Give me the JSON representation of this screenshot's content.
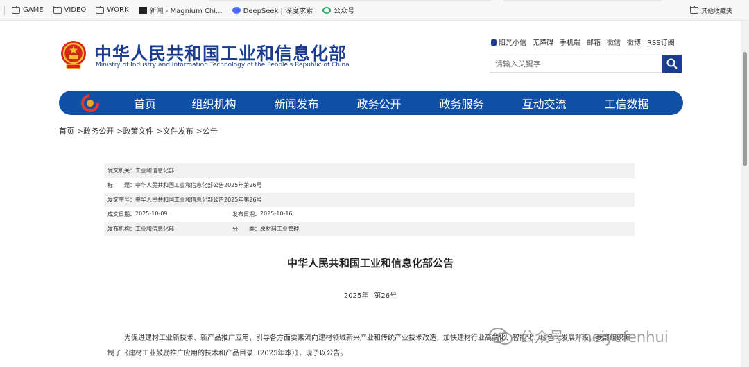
{
  "bookmarks": [
    {
      "label": "GAME",
      "icon": "folder-icon"
    },
    {
      "label": "VIDEO",
      "icon": "folder-icon"
    },
    {
      "label": "WORK",
      "icon": "folder-icon"
    },
    {
      "label": "新闻 - Magnium Chi...",
      "icon": "news-icon"
    },
    {
      "label": "DeepSeek | 深度求索",
      "icon": "deepseek-icon"
    },
    {
      "label": "公众号",
      "icon": "wechat-icon"
    }
  ],
  "bookmarks_other": "其他收藏夹",
  "site": {
    "title_cn": "中华人民共和国工业和信息化部",
    "title_en": "Ministry of Industry and Information Technology of the People's Republic of China"
  },
  "toplinks": [
    "阳光小信",
    "无障碍",
    "手机端",
    "邮箱",
    "微信",
    "微博",
    "RSS订阅"
  ],
  "search": {
    "placeholder": "请输入关键字"
  },
  "nav": [
    "首页",
    "组织机构",
    "新闻发布",
    "政务公开",
    "政务服务",
    "互动交流",
    "工信数据"
  ],
  "breadcrumb": [
    "首页",
    "政务公开",
    "政策文件",
    "文件发布",
    "公告"
  ],
  "breadcrumb_sep": ">",
  "meta": {
    "issuer_label": "发文机关：",
    "issuer": "工业和信息化部",
    "title_label": "标　　题：",
    "title": "中华人民共和国工业和信息化部公告2025年第26号",
    "docno_label": "发文字号：",
    "docno": "中华人民共和国工业和信息化部公告2025年第26号",
    "created_label": "成文日期：",
    "created": "2025-10-09",
    "published_label": "发布日期：",
    "published": "2025-10-16",
    "org_label": "发布机构：",
    "org": "工业和信息化部",
    "category_label": "分　　类：",
    "category": "原材料工业管理"
  },
  "article": {
    "title": "中华人民共和国工业和信息化部公告",
    "year": "2025年",
    "number": "第26号",
    "body": "为促进建材工业新技术、新产品推广应用，引导各方面要素流向建材领域新兴产业和传统产业技术改造，加快建材行业高端化、智能化、绿色化发展升级，我部组织编制了《建材工业鼓励推广应用的技术和产品目录（2025年本）》，现予以公告。"
  },
  "watermark": "公众号 · meiyefenhui",
  "colors": {
    "brand_blue": "#1a3d8f",
    "nav_blue": "#0f4fa5"
  }
}
